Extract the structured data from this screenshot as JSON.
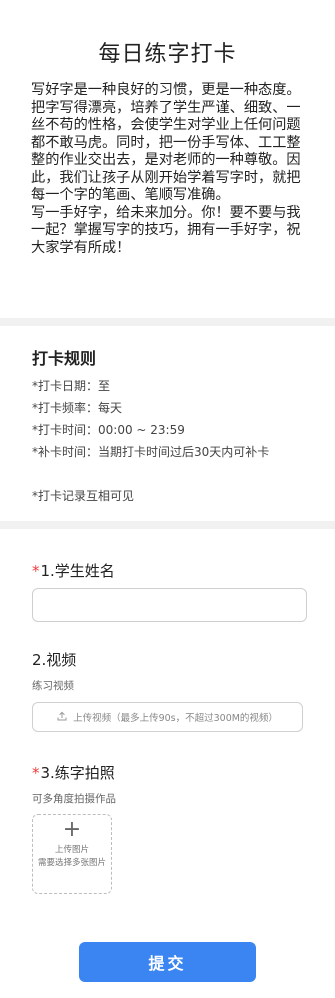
{
  "page": {
    "title": "每日练字打卡",
    "intro": "写好字是一种良好的习惯，更是一种态度。把字写得漂亮，培养了学生严谨、细致、一丝不苟的性格，会使学生对学业上任何问题都不敢马虎。同时，把一份手写体、工工整整的作业交出去，是对老师的一种尊敬。因此，我们让孩子从刚开始学着写字时，就把每一个字的笔画、笔顺写准确。\n写一手好字，给未来加分。你！要不要与我一起？掌握写字的技巧，拥有一手好字，祝大家学有所成！"
  },
  "rules": {
    "title": "打卡规则",
    "items": [
      "*打卡日期：至",
      "*打卡频率：每天",
      "*打卡时间：00:00 ~ 23:59",
      "*补卡时间：当期打卡时间过后30天内可补卡",
      "*打卡记录互相可见"
    ]
  },
  "form": {
    "required_mark": "*",
    "q1": {
      "label": "1.学生姓名",
      "value": "",
      "placeholder": ""
    },
    "q2": {
      "label": "2.视频",
      "hint": "练习视频",
      "upload_label": "上传视频（最多上传90s，不超过300M的视频）",
      "icon": "upload-icon"
    },
    "q3": {
      "label": "3.练字拍照",
      "hint": "可多角度拍摄作品",
      "plus": "+",
      "upload_label": "上传图片",
      "upload_sub": "需要选择多张图片"
    }
  },
  "submit": {
    "label": "提交"
  },
  "colors": {
    "accent": "#3a85f2",
    "required": "#ee3b3b",
    "divider": "#f1f1f1"
  }
}
